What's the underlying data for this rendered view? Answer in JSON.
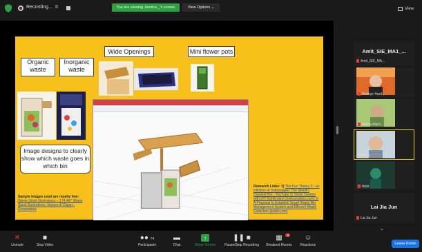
{
  "topbar": {
    "recording_label": "Recording...",
    "pause_label": "II",
    "viewing_banner": "You are viewing Jessica _'s screen",
    "view_options": "View Options ⌄",
    "view_label": "View"
  },
  "slide": {
    "label_organic": "Organic waste",
    "label_inorganic": "Inorganic waste",
    "label_wide": "Wide Openings",
    "label_mini": "Mini flower pots",
    "label_designs": "Image designs to clearly show which waste goes in which bin",
    "sample_prefix": "Sample images used are royalty free:",
    "sample_links": "Waste Stock Illustrations – 174,467 Waste Stock Illustrations, Vectors & Clipart - Dreamstime",
    "research_prefix": "Research Links: 1)",
    "research_links": "The Fun Theory 2 - an initiative of Volkswagen: The World's Deepest Bin - YouTube 2) Smart Dustbin with IOT Notification (instructables.com) 3) A Proposal to Establish Smart Waste Bin Management System and Efficient Waste Collection (ijsrbd.com)"
  },
  "participants": {
    "top_name": "Amit_SIE_MA1_...",
    "top_sub": "Amit_SIE_MA...",
    "p1": "Birdeye Hard...",
    "p2": "Aditya Atgra...",
    "p3": "Jessica",
    "p4": "Arpa",
    "bottom_name": "Lai Jia Jun",
    "bottom_sub": "Lai Jia Jun"
  },
  "toolbar": {
    "unmute": "Unmute",
    "stop_video": "Stop Video",
    "participants": "Participants",
    "participants_count": "74",
    "chat": "Chat",
    "share_screen": "Share Screen",
    "pause_recording": "Pause/Stop Recording",
    "breakout_rooms": "Breakout Rooms",
    "breakout_badge": "4",
    "reactions": "Reactions",
    "leave": "Leave Room"
  },
  "colors": {
    "slide_bg": "#f7c01a",
    "share_green": "#2ea043",
    "leave_blue": "#1a73e8",
    "mic_red": "#e03c3c"
  }
}
